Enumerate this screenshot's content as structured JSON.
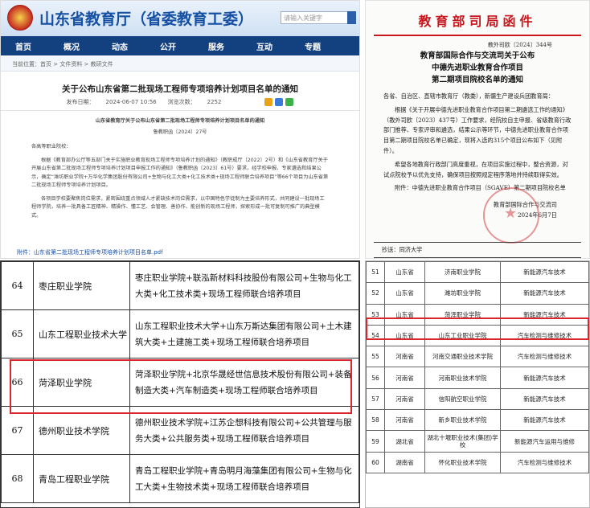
{
  "portal": {
    "site_title": "山东省教育厅（省委教育工委）",
    "search_placeholder": "请输入关键字",
    "nav": [
      {
        "label": "首页"
      },
      {
        "label": "概况"
      },
      {
        "label": "动态"
      },
      {
        "label": "公开"
      },
      {
        "label": "服务"
      },
      {
        "label": "互动"
      },
      {
        "label": "专题"
      }
    ],
    "breadcrumb": "当前位置：首页 > 文件资料 > 教研文件",
    "title": "关于公布山东省第二批现场工程师专项培养计划项目名单的通知",
    "meta": {
      "date_label": "发布日期：",
      "date": "2024-06-07 10:56",
      "views_label": "浏览次数：",
      "views": "2252"
    },
    "doc_title": "山东省教育厅关于公布山东省第二批现场工程师专项培养计划项目名单的通知",
    "doc_no": "鲁教职函〔2024〕27号",
    "salutation": "各高等职业院校：",
    "para1": "根据《教育部办公厅等五部门关于实施职业教育现场工程师专项培养计划的通知》（教职成厅〔2022〕2号）和《山东省教育厅关于开展山东省第二批现场工程师专项培养计划项目申报工作的通知》（鲁教职函〔2023〕61号）要求，经学校申报、专家遴选和结果公示，确定“潍坊职业学院+万华化学集团股份有限公司+生物与化工大类+化工技术类+现场工程师联合培养项目”等66个项目为山东省第二批现场工程师专项培养计划项目。",
    "para2": "各项目学校要聚焦岗位需求，紧密围绕重点领域人才紧缺技术岗位需求，以中国特色学徒制为主要培养形式，共同建设一批现场工程师学院，培养一批具备工匠精神、精操作、懂工艺、会管理、善协作、能创新的现场工程师，探索形成一批可复制可推广的典型模式。",
    "attachment": "附件：山东省第二批现场工程师专项培养计划项目名单.pdf"
  },
  "letter": {
    "header": "教育部司局函件",
    "doc_no": "教外司欧〔2024〕344号",
    "title_lines": [
      "教育部国际合作与交流司关于公布",
      "中德先进职业教育合作项目",
      "第二期项目院校名单的通知"
    ],
    "salutation": "各省、自治区、直辖市教育厅（教委），新疆生产建设兵团教育局：",
    "para1": "根据《关于开展中德先进职业教育合作项目第二期遴选工作的通知》（教外司欧〔2023〕437号）工作要求，经院校自主申报、省级教育行政部门推荐、专家评审和遴选，结果公示等环节，中德先进职业教育合作项目第二期项目院校名单已确定，现将入选的315个项目公布如下（见附件）。",
    "para2": "希望各地教育行政部门高度重视，在项目实施过程中，整合资源，对试点院校予以优先支持，确保项目按照规定程序落地并持续取得实效。",
    "attachment": "附件：中德先进职业教育合作项目（SGAVE）第二期项目院校名单",
    "signer": "教育部国际合作与交流司",
    "date": "2024年6月7日",
    "cc": "抄送：同济大学"
  },
  "table_left": {
    "rows": [
      {
        "no": "64",
        "school": "枣庄职业学院",
        "project": "枣庄职业学院+联泓新材料科技股份有限公司+生物与化工大类+化工技术类+现场工程师联合培养项目"
      },
      {
        "no": "65",
        "school": "山东工程职业技术大学",
        "project": "山东工程职业技术大学+山东万斯达集团有限公司+土木建筑大类+土建施工类+现场工程师联合培养项目"
      },
      {
        "no": "66",
        "school": "菏泽职业学院",
        "project": "菏泽职业学院+北京华晟经世信息技术股份有限公司+装备制造大类+汽车制造类+现场工程师联合培养项目"
      },
      {
        "no": "67",
        "school": "德州职业技术学院",
        "project": "德州职业技术学院+江苏企想科技有限公司+公共管理与服务大类+公共服务类+现场工程师联合培养项目"
      },
      {
        "no": "68",
        "school": "青岛工程职业学院",
        "project": "青岛工程职业学院+青岛明月海藻集团有限公司+生物与化工大类+生物技术类+现场工程师联合培养项目"
      }
    ]
  },
  "table_right": {
    "rows": [
      {
        "no": "51",
        "prov": "山东省",
        "school": "济南职业学院",
        "field": "新能源汽车技术"
      },
      {
        "no": "52",
        "prov": "山东省",
        "school": "潍坊职业学院",
        "field": "新能源汽车技术"
      },
      {
        "no": "53",
        "prov": "山东省",
        "school": "菏泽职业学院",
        "field": "新能源汽车技术"
      },
      {
        "no": "54",
        "prov": "山东省",
        "school": "山东工业职业学院",
        "field": "汽车检测与维修技术"
      },
      {
        "no": "55",
        "prov": "河南省",
        "school": "河南交通职业技术学院",
        "field": "汽车检测与维修技术"
      },
      {
        "no": "56",
        "prov": "河南省",
        "school": "河南职业技术学院",
        "field": "新能源汽车技术"
      },
      {
        "no": "57",
        "prov": "河南省",
        "school": "信阳航空职业学院",
        "field": "新能源汽车技术"
      },
      {
        "no": "58",
        "prov": "河南省",
        "school": "新乡职业技术学院",
        "field": "新能源汽车技术"
      },
      {
        "no": "59",
        "prov": "湖北省",
        "school": "湖北十堰职业技术(集团)学校",
        "field": "新能源汽车运用与维修"
      },
      {
        "no": "60",
        "prov": "湖南省",
        "school": "怀化职业技术学院",
        "field": "汽车检测与维修技术"
      }
    ]
  }
}
